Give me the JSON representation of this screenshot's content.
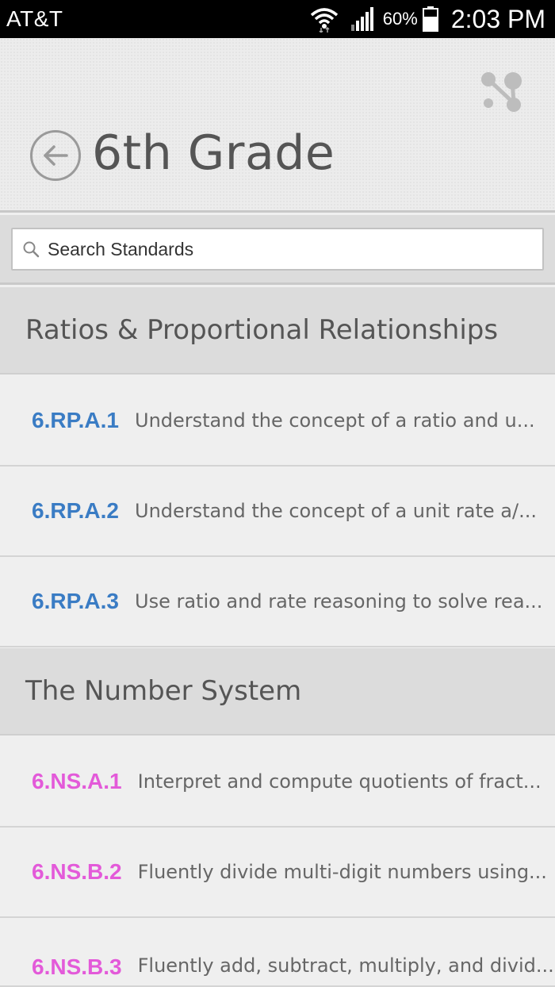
{
  "status_bar": {
    "carrier": "AT&T",
    "battery": "60%",
    "time": "2:03 PM"
  },
  "header": {
    "title": "6th Grade",
    "back_icon": "back-arrow-icon",
    "share_icon": "share-icon"
  },
  "search": {
    "placeholder": "Search Standards",
    "value": ""
  },
  "colors": {
    "rp_code": "#3a7cc4",
    "ns_code": "#e35ad9"
  },
  "sections": [
    {
      "title": "Ratios & Proportional Relationships",
      "items": [
        {
          "code": "6.RP.A.1",
          "description": "Understand the concept of a ratio and u..."
        },
        {
          "code": "6.RP.A.2",
          "description": "Understand the concept of a unit rate a/..."
        },
        {
          "code": "6.RP.A.3",
          "description": "Use ratio and rate reasoning to solve rea..."
        }
      ]
    },
    {
      "title": "The Number System",
      "items": [
        {
          "code": "6.NS.A.1",
          "description": "Interpret and compute quotients of fract..."
        },
        {
          "code": "6.NS.B.2",
          "description": "Fluently divide multi-digit numbers using..."
        },
        {
          "code": "6.NS.B.3",
          "description": "Fluently add, subtract, multiply, and divid..."
        }
      ]
    }
  ]
}
